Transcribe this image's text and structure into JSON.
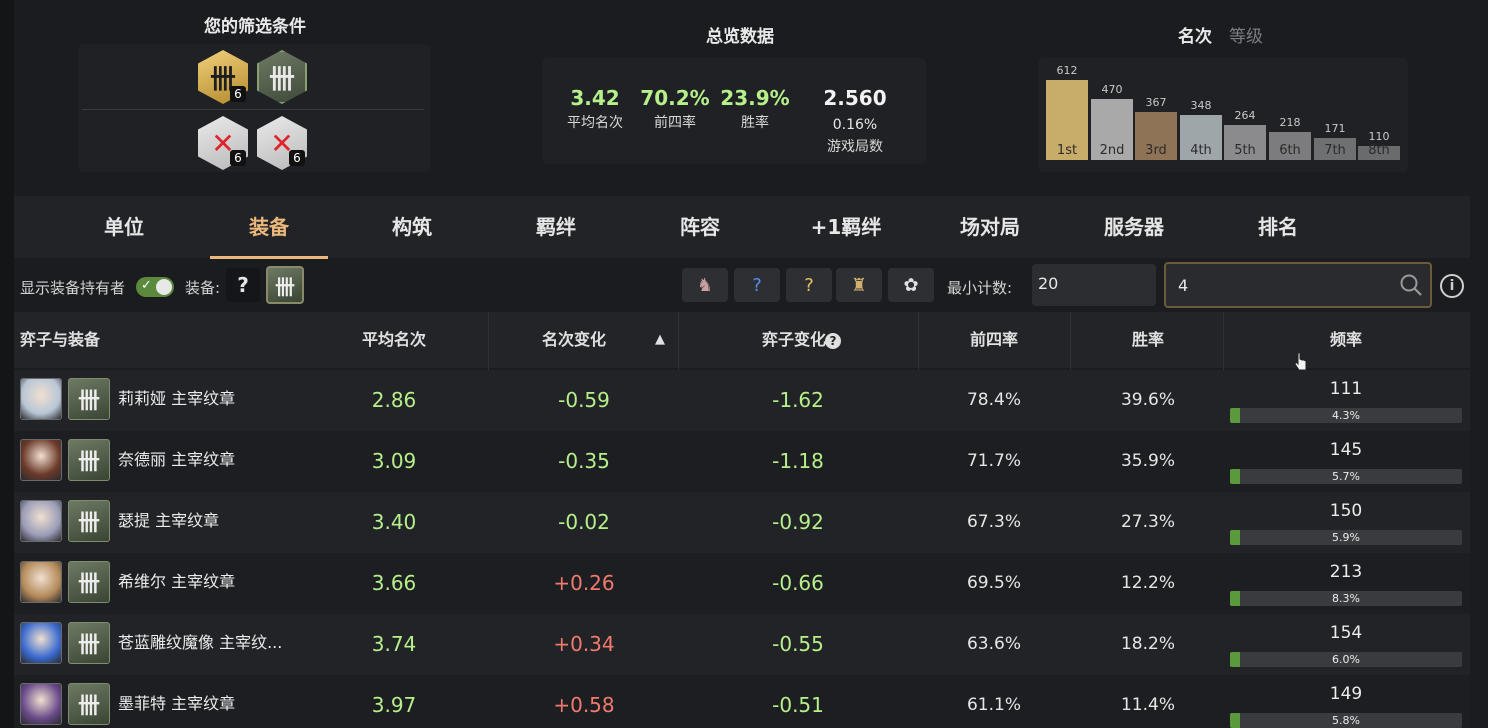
{
  "filters": {
    "title": "您的筛选条件",
    "items": [
      {
        "icon": "gold-emblem-icon",
        "count": "6"
      },
      {
        "icon": "green-emblem-icon",
        "count": ""
      },
      {
        "icon": "excluded-emblem-icon",
        "count": "6"
      },
      {
        "icon": "excluded-emblem-icon",
        "count": "6"
      }
    ]
  },
  "overview": {
    "title": "总览数据",
    "avg_place": {
      "value": "3.42",
      "label": "平均名次"
    },
    "top4": {
      "value": "70.2%",
      "label": "前四率"
    },
    "win": {
      "value": "23.9%",
      "label": "胜率"
    },
    "games": {
      "value": "2.560",
      "sub": "0.16%",
      "label": "游戏局数"
    }
  },
  "placement": {
    "title": "名次",
    "alt_title": "等级",
    "bars": [
      {
        "label": "1st",
        "count": 612,
        "color": "#c8ac6a"
      },
      {
        "label": "2nd",
        "count": 470,
        "color": "#a9a9a9"
      },
      {
        "label": "3rd",
        "count": 367,
        "color": "#8e7356"
      },
      {
        "label": "4th",
        "count": 348,
        "color": "#9fa6aa"
      },
      {
        "label": "5th",
        "count": 264,
        "color": "#8b8b8d"
      },
      {
        "label": "6th",
        "count": 218,
        "color": "#7c7c7e"
      },
      {
        "label": "7th",
        "count": 171,
        "color": "#6f7071"
      },
      {
        "label": "8th",
        "count": 110,
        "color": "#6a6b6c"
      }
    ]
  },
  "tabs": [
    "单位",
    "装备",
    "构筑",
    "羁绊",
    "阵容",
    "+1羁绊",
    "场对局",
    "服务器",
    "排名"
  ],
  "active_tab": "装备",
  "controls": {
    "show_holder_label": "显示装备持有者",
    "item_label": "装备:",
    "min_count_label": "最小计数:",
    "min_count_value": "20",
    "search_value": "4",
    "info": "i"
  },
  "table": {
    "headers": {
      "unit_item": "弈子与装备",
      "avg": "平均名次",
      "place_change": "名次变化",
      "sort_arrow": "▲",
      "unit_change": "弈子变化",
      "help": "?",
      "top4": "前四率",
      "win": "胜率",
      "freq": "频率"
    },
    "rows": [
      {
        "name": "莉莉娅 主宰纹章",
        "avg": "2.86",
        "delta": "-0.59",
        "unit_delta": "-1.62",
        "top4": "78.4%",
        "win": "39.6%",
        "count": "111",
        "freq": "4.3%",
        "freq_value": 0.043,
        "champ_color": "#b8c6d6"
      },
      {
        "name": "奈德丽 主宰纹章",
        "avg": "3.09",
        "delta": "-0.35",
        "unit_delta": "-1.18",
        "top4": "71.7%",
        "win": "35.9%",
        "count": "145",
        "freq": "5.7%",
        "freq_value": 0.057,
        "champ_color": "#6b3a2a"
      },
      {
        "name": "瑟提 主宰纹章",
        "avg": "3.40",
        "delta": "-0.02",
        "unit_delta": "-0.92",
        "top4": "67.3%",
        "win": "27.3%",
        "count": "150",
        "freq": "5.9%",
        "freq_value": 0.059,
        "champ_color": "#9a9cb8"
      },
      {
        "name": "希维尔 主宰纹章",
        "avg": "3.66",
        "delta": "+0.26",
        "unit_delta": "-0.66",
        "top4": "69.5%",
        "win": "12.2%",
        "count": "213",
        "freq": "8.3%",
        "freq_value": 0.083,
        "champ_color": "#b48a5a"
      },
      {
        "name": "苍蓝雕纹魔像 主宰纹...",
        "avg": "3.74",
        "delta": "+0.34",
        "unit_delta": "-0.55",
        "top4": "63.6%",
        "win": "18.2%",
        "count": "154",
        "freq": "6.0%",
        "freq_value": 0.06,
        "champ_color": "#3a6ad0"
      },
      {
        "name": "墨菲特 主宰纹章",
        "avg": "3.97",
        "delta": "+0.58",
        "unit_delta": "-0.51",
        "top4": "61.1%",
        "win": "11.4%",
        "count": "149",
        "freq": "5.8%",
        "freq_value": 0.058,
        "champ_color": "#6a4a8a"
      }
    ]
  }
}
